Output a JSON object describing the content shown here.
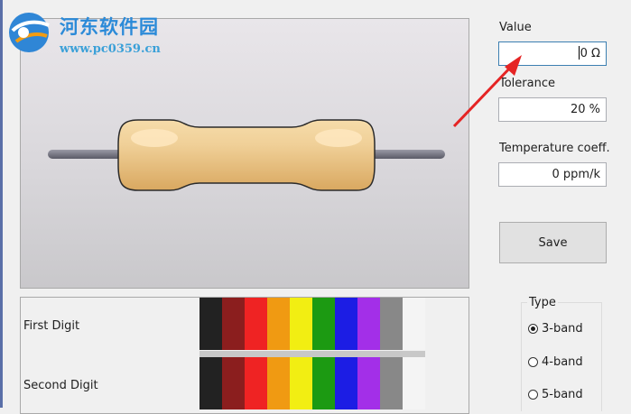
{
  "watermark": {
    "title": "河东软件园",
    "url": "www.pc0359.cn"
  },
  "fields": {
    "value": {
      "label": "Value",
      "text": "0 Ω"
    },
    "tolerance": {
      "label": "Tolerance",
      "text": "20 %"
    },
    "temp": {
      "label": "Temperature coeff.",
      "text": "0 ppm/k"
    }
  },
  "save_label": "Save",
  "type_group": {
    "legend": "Type",
    "options": [
      "3-band",
      "4-band",
      "5-band"
    ],
    "selected": "3-band"
  },
  "digits": {
    "first_label": "First Digit",
    "second_label": "Second Digit"
  },
  "band_colors": [
    {
      "name": "black",
      "hex": "#222222"
    },
    {
      "name": "brown",
      "hex": "#8b1e1e"
    },
    {
      "name": "red",
      "hex": "#ef2323"
    },
    {
      "name": "orange",
      "hex": "#f09a12"
    },
    {
      "name": "yellow",
      "hex": "#f2ee12"
    },
    {
      "name": "green",
      "hex": "#1c9a12"
    },
    {
      "name": "blue",
      "hex": "#1c1de4"
    },
    {
      "name": "violet",
      "hex": "#a32fe8"
    },
    {
      "name": "grey",
      "hex": "#888888"
    },
    {
      "name": "white",
      "hex": "#f4f4f4"
    }
  ],
  "colors": {
    "annotation_arrow": "#e52424",
    "resistor_body": "#e8c48a"
  }
}
